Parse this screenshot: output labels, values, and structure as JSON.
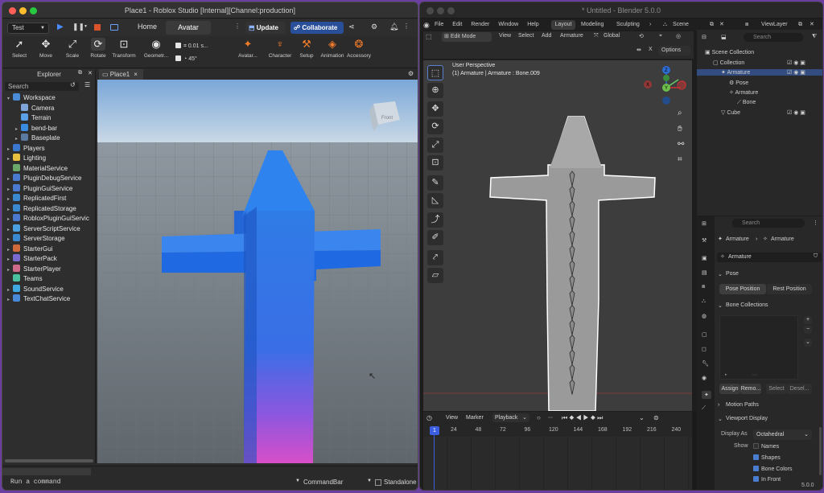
{
  "roblox": {
    "window_title": "Place1 - Roblox Studio [Internal][Channel:production]",
    "mode_select": "Test",
    "tabs": [
      "Home",
      "Avatar"
    ],
    "update_label": "Update",
    "collaborate_label": "Collaborate",
    "tools": [
      "Select",
      "Move",
      "Scale",
      "Rotate",
      "Transform",
      "Geometr...",
      "Avatar...",
      "Character",
      "Setup",
      "Animation",
      "Accessory"
    ],
    "move_increment": "0.01 s...",
    "rotate_increment": "45°",
    "explorer_title": "Explorer",
    "explorer_search_placeholder": "Search",
    "tree": [
      "Workspace",
      "Camera",
      "Terrain",
      "bend-bar",
      "Baseplate",
      "Players",
      "Lighting",
      "MaterialService",
      "PluginDebugService",
      "PluginGuiService",
      "ReplicatedFirst",
      "ReplicatedStorage",
      "RobloxPluginGuiServic",
      "ServerScriptService",
      "ServerStorage",
      "StarterGui",
      "StarterPack",
      "StarterPlayer",
      "Teams",
      "SoundService",
      "TextChatService"
    ],
    "viewport_tab": "Place1",
    "view_cube_label": "Front",
    "command_placeholder": "Run a command",
    "commandbar_label": "CommandBar",
    "standalone_label": "Standalone"
  },
  "blender": {
    "window_title": "* Untitled - Blender 5.0.0",
    "menus": [
      "File",
      "Edit",
      "Render",
      "Window",
      "Help"
    ],
    "workspaces": [
      "Layout",
      "Modeling",
      "Sculpting"
    ],
    "scene": "Scene",
    "view_layer": "ViewLayer",
    "mode": "Edit Mode",
    "header_menus": [
      "View",
      "Select",
      "Add",
      "Armature"
    ],
    "transform_orientation": "Global",
    "options_label": "Options",
    "x_label": "X",
    "viewport_perspective": "User Perspective",
    "viewport_info": "(1) Armature | Armature : Bone.009",
    "outliner_search_placeholder": "Search",
    "outliner": [
      "Scene Collection",
      "Collection",
      "Armature",
      "Pose",
      "Armature",
      "Bone",
      "Cube"
    ],
    "props_search_placeholder": "Search",
    "breadcrumb": [
      "Armature",
      "Armature"
    ],
    "data_name": "Armature",
    "pose_section": "Pose",
    "pose_position": "Pose Position",
    "rest_position": "Rest Position",
    "bone_collections": "Bone Collections",
    "assign": "Assign",
    "remove": "Remo...",
    "select": "Select",
    "deselect": "Desel...",
    "motion_paths": "Motion Paths",
    "viewport_display": "Viewport Display",
    "display_as_label": "Display As",
    "display_as_value": "Octahedral",
    "show_label": "Show",
    "show_options": [
      "Names",
      "Shapes",
      "Bone Colors",
      "In Front"
    ],
    "timeline_menus": [
      "View",
      "Marker",
      "Playback"
    ],
    "frames": [
      "1",
      "24",
      "48",
      "72",
      "96",
      "120",
      "144",
      "168",
      "192",
      "216",
      "240"
    ],
    "version": "5.0.0"
  }
}
